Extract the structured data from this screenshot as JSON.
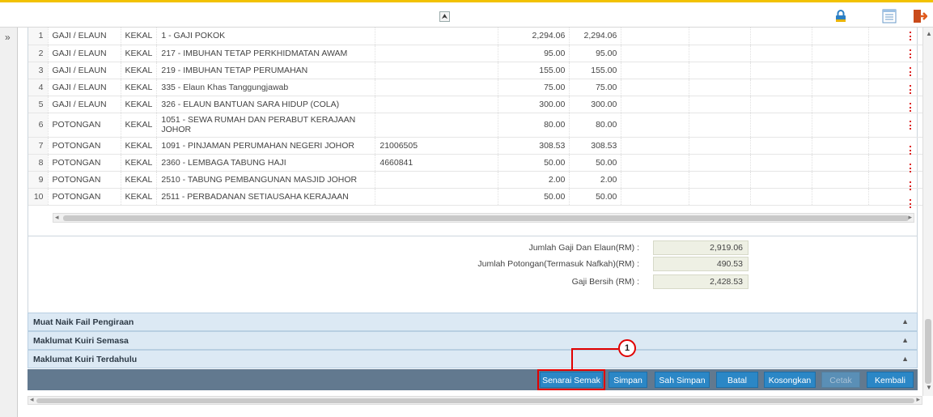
{
  "toolbar": {
    "collapse_symbol": "⮝",
    "expand_symbol": "»",
    "icons": [
      "lock-icon",
      "list-icon",
      "logout-icon"
    ]
  },
  "rows": [
    {
      "no": "1",
      "type": "GAJI / ELAUN",
      "status": "KEKAL",
      "desc": "1 - GAJI POKOK",
      "ref": "",
      "amount1": "2,294.06",
      "amount2": "2,294.06"
    },
    {
      "no": "2",
      "type": "GAJI / ELAUN",
      "status": "KEKAL",
      "desc": "217 - IMBUHAN TETAP PERKHIDMATAN AWAM",
      "ref": "",
      "amount1": "95.00",
      "amount2": "95.00"
    },
    {
      "no": "3",
      "type": "GAJI / ELAUN",
      "status": "KEKAL",
      "desc": "219 - IMBUHAN TETAP PERUMAHAN",
      "ref": "",
      "amount1": "155.00",
      "amount2": "155.00"
    },
    {
      "no": "4",
      "type": "GAJI / ELAUN",
      "status": "KEKAL",
      "desc": "335 - Elaun Khas Tanggungjawab",
      "ref": "",
      "amount1": "75.00",
      "amount2": "75.00"
    },
    {
      "no": "5",
      "type": "GAJI / ELAUN",
      "status": "KEKAL",
      "desc": "326 - ELAUN BANTUAN SARA HIDUP (COLA)",
      "ref": "",
      "amount1": "300.00",
      "amount2": "300.00"
    },
    {
      "no": "6",
      "type": "POTONGAN",
      "status": "KEKAL",
      "desc": "1051 - SEWA RUMAH DAN PERABUT KERAJAAN JOHOR",
      "ref": "",
      "amount1": "80.00",
      "amount2": "80.00"
    },
    {
      "no": "7",
      "type": "POTONGAN",
      "status": "KEKAL",
      "desc": "1091 - PINJAMAN PERUMAHAN NEGERI JOHOR",
      "ref": "21006505",
      "amount1": "308.53",
      "amount2": "308.53"
    },
    {
      "no": "8",
      "type": "POTONGAN",
      "status": "KEKAL",
      "desc": "2360 - LEMBAGA TABUNG HAJI",
      "ref": "4660841",
      "amount1": "50.00",
      "amount2": "50.00"
    },
    {
      "no": "9",
      "type": "POTONGAN",
      "status": "KEKAL",
      "desc": "2510 - TABUNG PEMBANGUNAN MASJID JOHOR",
      "ref": "",
      "amount1": "2.00",
      "amount2": "2.00"
    },
    {
      "no": "10",
      "type": "POTONGAN",
      "status": "KEKAL",
      "desc": "2511 - PERBADANAN SETIAUSAHA KERAJAAN",
      "ref": "",
      "amount1": "50.00",
      "amount2": "50.00"
    }
  ],
  "summary": {
    "gross_label": "Jumlah Gaji Dan Elaun(RM) :",
    "gross_value": "2,919.06",
    "deduction_label": "Jumlah Potongan(Termasuk Nafkah)(RM) :",
    "deduction_value": "490.53",
    "net_label": "Gaji Bersih (RM) :",
    "net_value": "2,428.53"
  },
  "sections": [
    {
      "label": "Muat Naik Fail Pengiraan"
    },
    {
      "label": "Maklumat Kuiri Semasa"
    },
    {
      "label": "Maklumat Kuiri Terdahulu"
    }
  ],
  "buttons": {
    "senarai_semak": "Senarai Semak",
    "simpan": "Simpan",
    "sah_simpan": "Sah Simpan",
    "batal": "Batal",
    "kosongkan": "Kosongkan",
    "cetak": "Cetak",
    "kembali": "Kembali"
  },
  "callout": {
    "number": "1",
    "color": "#e10000"
  },
  "colors": {
    "accent_top": "#f2c200",
    "button_blue": "#2b87c6",
    "button_bar": "#62798f",
    "section_bg": "#dce9f4"
  }
}
